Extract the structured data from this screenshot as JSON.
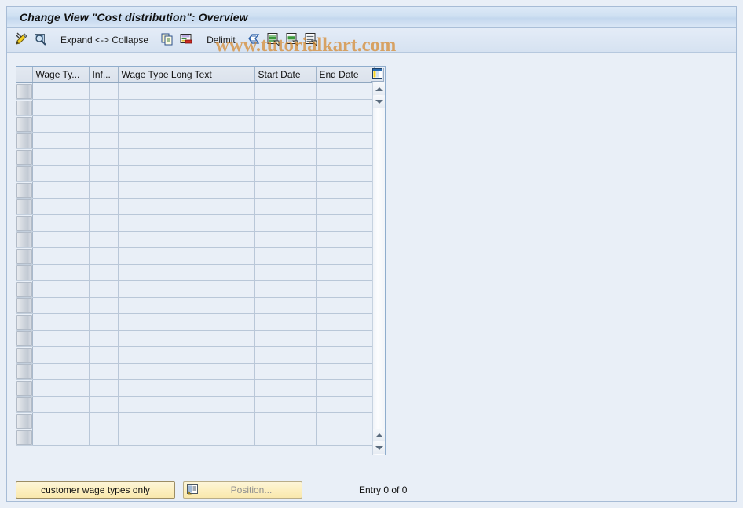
{
  "window": {
    "title": "Change View \"Cost distribution\": Overview"
  },
  "watermark": {
    "text": "www.tutorialkart.com",
    "color": "#d6882c"
  },
  "toolbar": {
    "items": [
      {
        "name": "display-change-icon",
        "icon": "pencil-icon",
        "label": ""
      },
      {
        "name": "details-icon",
        "icon": "magnifier-icon",
        "label": ""
      },
      {
        "name": "expand-collapse",
        "icon": "",
        "label": "Expand <-> Collapse"
      },
      {
        "name": "copy-as-icon",
        "icon": "copy-icon",
        "label": ""
      },
      {
        "name": "delete-icon",
        "icon": "delete-row-icon",
        "label": ""
      },
      {
        "name": "delimit",
        "icon": "",
        "label": "Delimit"
      },
      {
        "name": "undo-icon",
        "icon": "undo-arrow-icon",
        "label": ""
      },
      {
        "name": "previous-entry-icon",
        "icon": "list-green-icon",
        "label": ""
      },
      {
        "name": "next-entry-icon",
        "icon": "list-green-alt-icon",
        "label": ""
      },
      {
        "name": "variable-list-icon",
        "icon": "list-lines-icon",
        "label": ""
      }
    ],
    "expand_collapse_label": "Expand <-> Collapse",
    "delimit_label": "Delimit"
  },
  "table": {
    "columns": [
      {
        "key": "sel",
        "label": ""
      },
      {
        "key": "wt",
        "label": "Wage Ty..."
      },
      {
        "key": "inf",
        "label": "Inf..."
      },
      {
        "key": "long",
        "label": "Wage Type Long Text"
      },
      {
        "key": "sd",
        "label": "Start Date"
      },
      {
        "key": "ed",
        "label": "End Date"
      }
    ],
    "rows": [
      {
        "wt": "",
        "inf": "",
        "long": "",
        "sd": "",
        "ed": ""
      },
      {
        "wt": "",
        "inf": "",
        "long": "",
        "sd": "",
        "ed": ""
      },
      {
        "wt": "",
        "inf": "",
        "long": "",
        "sd": "",
        "ed": ""
      },
      {
        "wt": "",
        "inf": "",
        "long": "",
        "sd": "",
        "ed": ""
      },
      {
        "wt": "",
        "inf": "",
        "long": "",
        "sd": "",
        "ed": ""
      },
      {
        "wt": "",
        "inf": "",
        "long": "",
        "sd": "",
        "ed": ""
      },
      {
        "wt": "",
        "inf": "",
        "long": "",
        "sd": "",
        "ed": ""
      },
      {
        "wt": "",
        "inf": "",
        "long": "",
        "sd": "",
        "ed": ""
      },
      {
        "wt": "",
        "inf": "",
        "long": "",
        "sd": "",
        "ed": ""
      },
      {
        "wt": "",
        "inf": "",
        "long": "",
        "sd": "",
        "ed": ""
      },
      {
        "wt": "",
        "inf": "",
        "long": "",
        "sd": "",
        "ed": ""
      },
      {
        "wt": "",
        "inf": "",
        "long": "",
        "sd": "",
        "ed": ""
      },
      {
        "wt": "",
        "inf": "",
        "long": "",
        "sd": "",
        "ed": ""
      },
      {
        "wt": "",
        "inf": "",
        "long": "",
        "sd": "",
        "ed": ""
      },
      {
        "wt": "",
        "inf": "",
        "long": "",
        "sd": "",
        "ed": ""
      },
      {
        "wt": "",
        "inf": "",
        "long": "",
        "sd": "",
        "ed": ""
      },
      {
        "wt": "",
        "inf": "",
        "long": "",
        "sd": "",
        "ed": ""
      },
      {
        "wt": "",
        "inf": "",
        "long": "",
        "sd": "",
        "ed": ""
      },
      {
        "wt": "",
        "inf": "",
        "long": "",
        "sd": "",
        "ed": ""
      },
      {
        "wt": "",
        "inf": "",
        "long": "",
        "sd": "",
        "ed": ""
      },
      {
        "wt": "",
        "inf": "",
        "long": "",
        "sd": "",
        "ed": ""
      },
      {
        "wt": "",
        "inf": "",
        "long": "",
        "sd": "",
        "ed": ""
      }
    ]
  },
  "footer": {
    "customer_wage_types_label": "customer wage types only",
    "position_label": "Position...",
    "entry_count_label": "Entry 0 of 0"
  }
}
